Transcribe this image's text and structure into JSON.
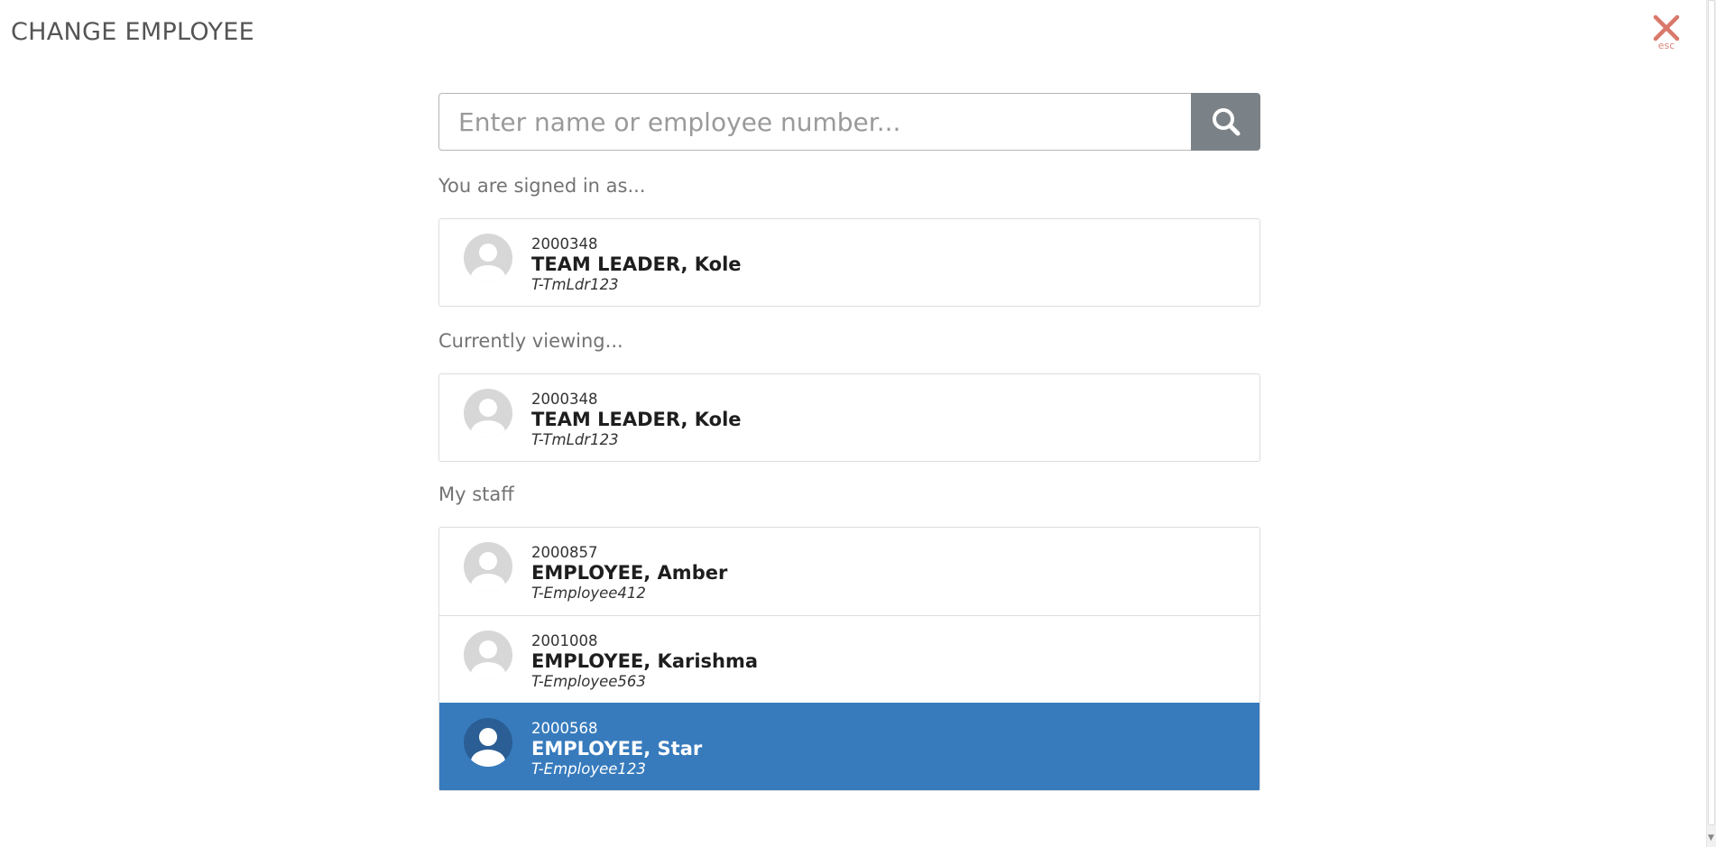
{
  "header": {
    "title": "CHANGE EMPLOYEE",
    "close_hint": "esc",
    "close_color": "#d9796b"
  },
  "search": {
    "placeholder": "Enter name or employee number...",
    "value": "",
    "button_icon": "search-icon"
  },
  "signed_in": {
    "label": "You are signed in as...",
    "employee": {
      "number": "2000348",
      "name": "TEAM LEADER, Kole",
      "login": "T-TmLdr123"
    }
  },
  "viewing": {
    "label": "Currently viewing...",
    "employee": {
      "number": "2000348",
      "name": "TEAM LEADER, Kole",
      "login": "T-TmLdr123"
    }
  },
  "staff": {
    "label": "My staff",
    "items": [
      {
        "number": "2000857",
        "name": "EMPLOYEE, Amber",
        "login": "T-Employee412",
        "selected": false
      },
      {
        "number": "2001008",
        "name": "EMPLOYEE, Karishma",
        "login": "T-Employee563",
        "selected": false
      },
      {
        "number": "2000568",
        "name": "EMPLOYEE, Star",
        "login": "T-Employee123",
        "selected": true
      }
    ]
  },
  "colors": {
    "selected_row": "#377bbd",
    "search_button": "#7b8287"
  }
}
